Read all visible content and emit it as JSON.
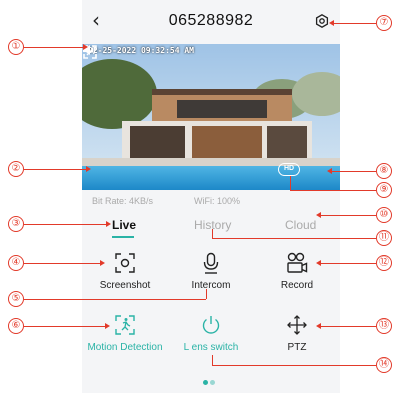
{
  "header": {
    "title": "065288982",
    "back_icon": "chevron-left-icon",
    "settings_icon": "settings-icon"
  },
  "video": {
    "timestamp": "02-25-2022 09:32:54 AM",
    "hd_label": "HD"
  },
  "stats": {
    "bit_rate": "Bit Rate: 4KB/s",
    "wifi": "WiFi: 100%"
  },
  "tabs": [
    {
      "label": "Live",
      "active": true
    },
    {
      "label": "History",
      "active": false
    },
    {
      "label": "Cloud",
      "active": false
    }
  ],
  "actions": {
    "screenshot": "Screenshot",
    "intercom": "Intercom",
    "record": "Record",
    "motion": "Motion Detection",
    "lens": "L ens switch",
    "ptz": "PTZ"
  },
  "callouts": [
    "①",
    "②",
    "③",
    "④",
    "⑤",
    "⑥",
    "⑦",
    "⑧",
    "⑨",
    "⑩",
    "⑪",
    "⑫",
    "⑬",
    "⑭"
  ],
  "colors": {
    "accent": "#2ab3a6",
    "callout": "#e23a2a"
  }
}
